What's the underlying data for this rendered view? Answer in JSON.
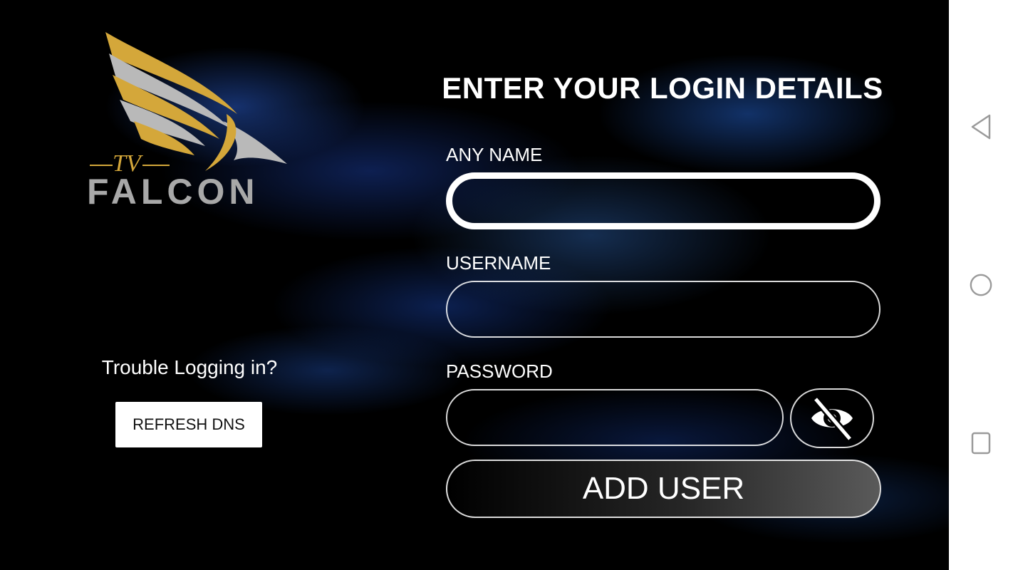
{
  "logo": {
    "small_text": "TV",
    "brand_text": "FALCON",
    "gold": "#d4a73a",
    "silver": "#a8a8a8"
  },
  "login": {
    "title": "ENTER YOUR LOGIN DETAILS",
    "any_name_label": "ANY NAME",
    "any_name_value": "",
    "username_label": "USERNAME",
    "username_value": "",
    "password_label": "PASSWORD",
    "password_value": "",
    "toggle_icon": "eye-off-icon",
    "add_user_label": "ADD USER"
  },
  "help": {
    "trouble_text": "Trouble Logging in?",
    "refresh_label": "REFRESH DNS"
  },
  "system_nav": {
    "back_icon": "back-triangle-icon",
    "home_icon": "home-circle-icon",
    "recents_icon": "recents-square-icon"
  }
}
